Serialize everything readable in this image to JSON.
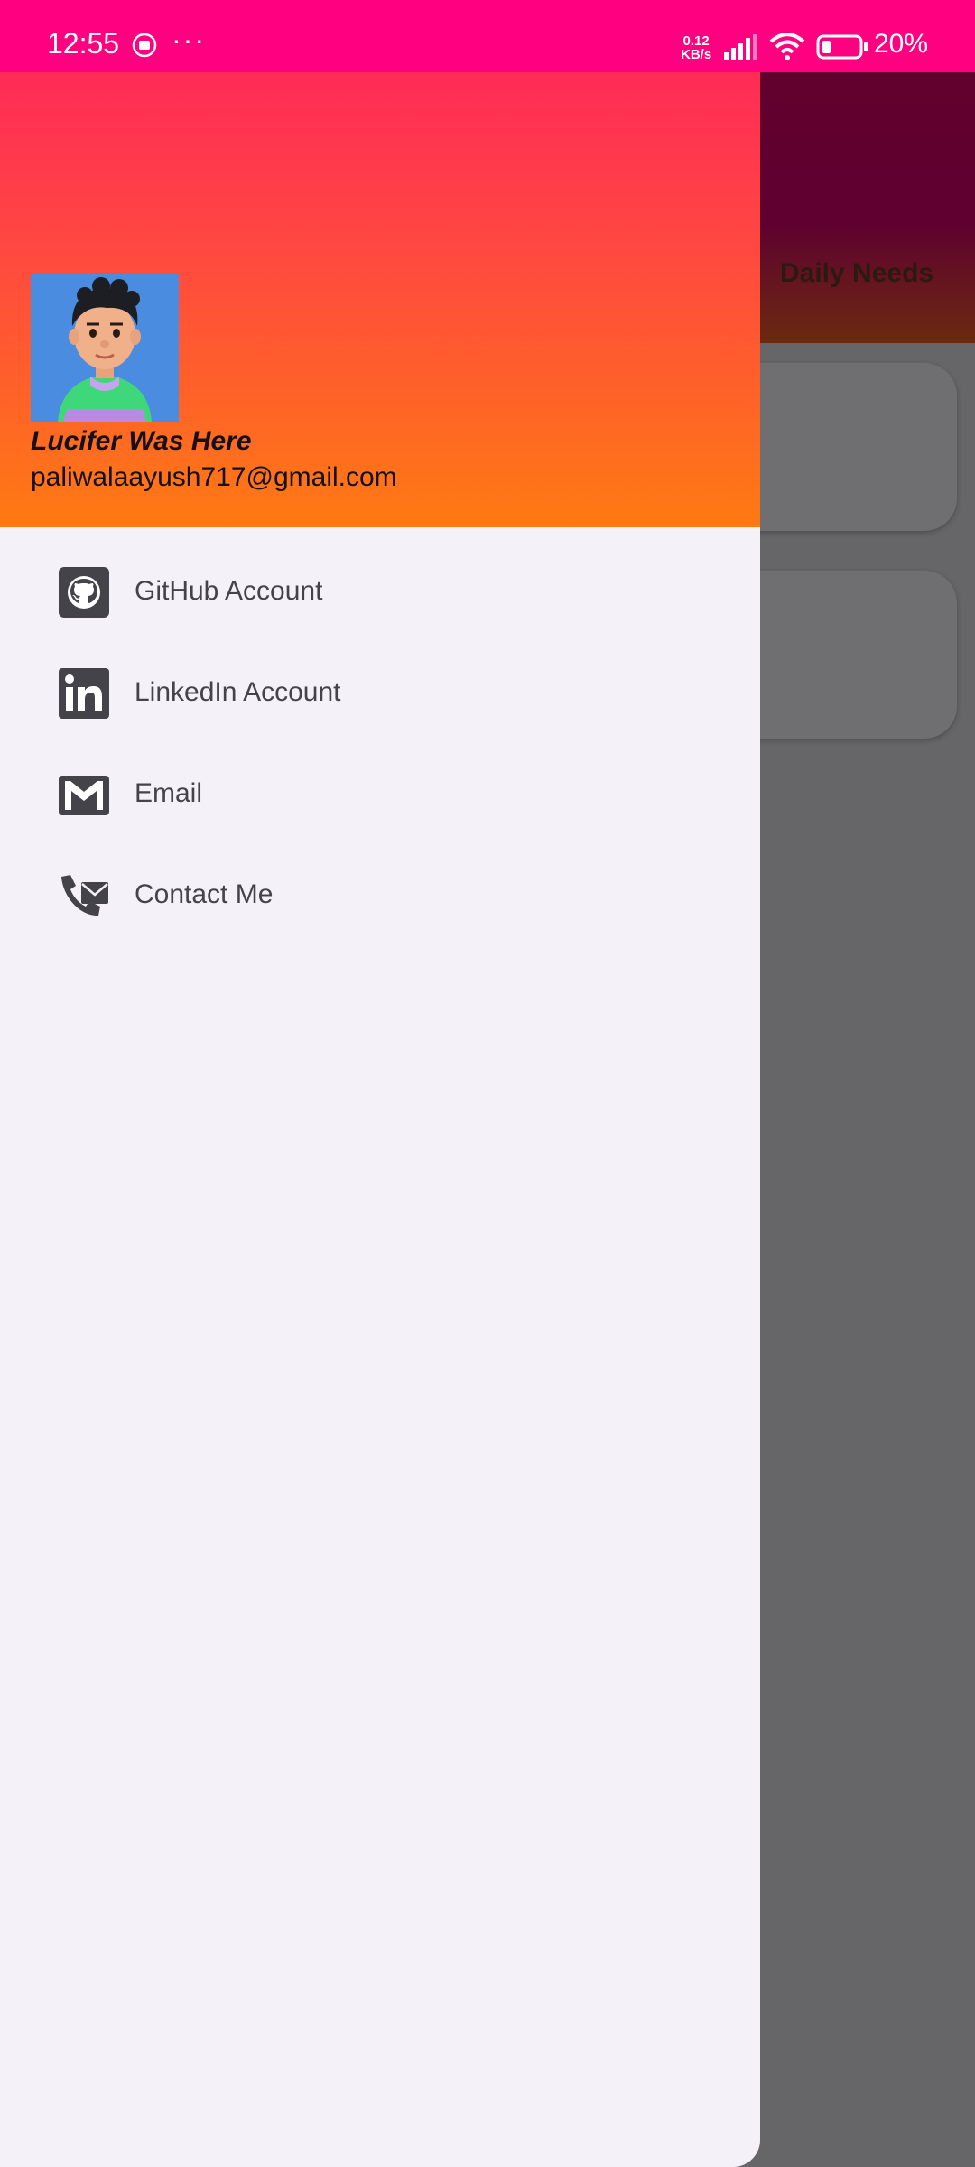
{
  "status_bar": {
    "time": "12:55",
    "overflow": "···",
    "net_speed_value": "0.12",
    "net_speed_unit": "KB/s",
    "battery": "20%",
    "icons": [
      "record-icon",
      "signal-icon",
      "wifi-icon",
      "battery-icon"
    ]
  },
  "background": {
    "title": "Daily Needs"
  },
  "drawer": {
    "user_name": "Lucifer Was Here",
    "user_email": "paliwalaayush717@gmail.com",
    "items": [
      {
        "label": "GitHub Account",
        "icon": "github-icon"
      },
      {
        "label": "LinkedIn Account",
        "icon": "linkedin-icon"
      },
      {
        "label": "Email",
        "icon": "gmail-icon"
      },
      {
        "label": "Contact Me",
        "icon": "contact-icon"
      }
    ]
  },
  "colors": {
    "status_bar": "#ff0080",
    "header_top": "#ff2b58",
    "header_bottom": "#ff7a12",
    "drawer_bg": "#f5f1f8",
    "scrim": "#666568"
  }
}
